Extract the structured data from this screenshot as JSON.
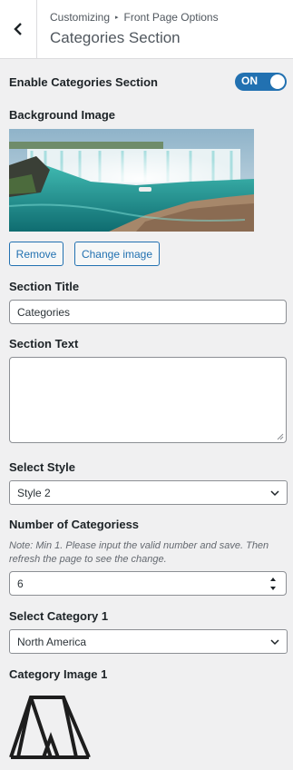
{
  "header": {
    "breadcrumb_root": "Customizing",
    "breadcrumb_separator": "▸",
    "breadcrumb_parent": "Front Page Options",
    "title": "Categories Section",
    "back_icon": "chevron-left-icon"
  },
  "enable_section": {
    "label": "Enable Categories Section",
    "toggle_text": "ON",
    "state": true
  },
  "background_image": {
    "label": "Background Image",
    "preview": "waterfall-photo",
    "remove_label": "Remove",
    "change_label": "Change image"
  },
  "section_title": {
    "label": "Section Title",
    "value": "Categories"
  },
  "section_text": {
    "label": "Section Text",
    "value": ""
  },
  "select_style": {
    "label": "Select Style",
    "value": "Style 2"
  },
  "number_of_categories": {
    "label": "Number of Categoriess",
    "note": "Note: Min 1. Please input the valid number and save. Then refresh the page to see the change.",
    "value": "6"
  },
  "select_category_1": {
    "label": "Select Category 1",
    "value": "North America"
  },
  "category_image_1": {
    "label": "Category Image 1",
    "preview": "tent-logo-icon"
  },
  "colors": {
    "accent": "#2271b1",
    "background": "#f0f0f1",
    "panel": "#ffffff",
    "border": "#8c8f94"
  }
}
